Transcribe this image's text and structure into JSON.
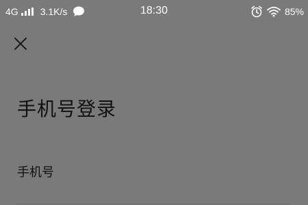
{
  "status_bar": {
    "network_type": "4G",
    "network_speed": "3.1K/s",
    "time": "18:30",
    "battery": "85%",
    "icons": [
      "signal-icon",
      "chat-bubble-icon",
      "alarm-icon",
      "wifi-icon"
    ]
  },
  "header": {
    "close_icon": "close-icon"
  },
  "main": {
    "title": "手机号登录",
    "phone_label": "手机号",
    "phone_value": ""
  },
  "colors": {
    "background": "#7a7a7a",
    "text": "#111111",
    "status_text": "#ffffff"
  }
}
